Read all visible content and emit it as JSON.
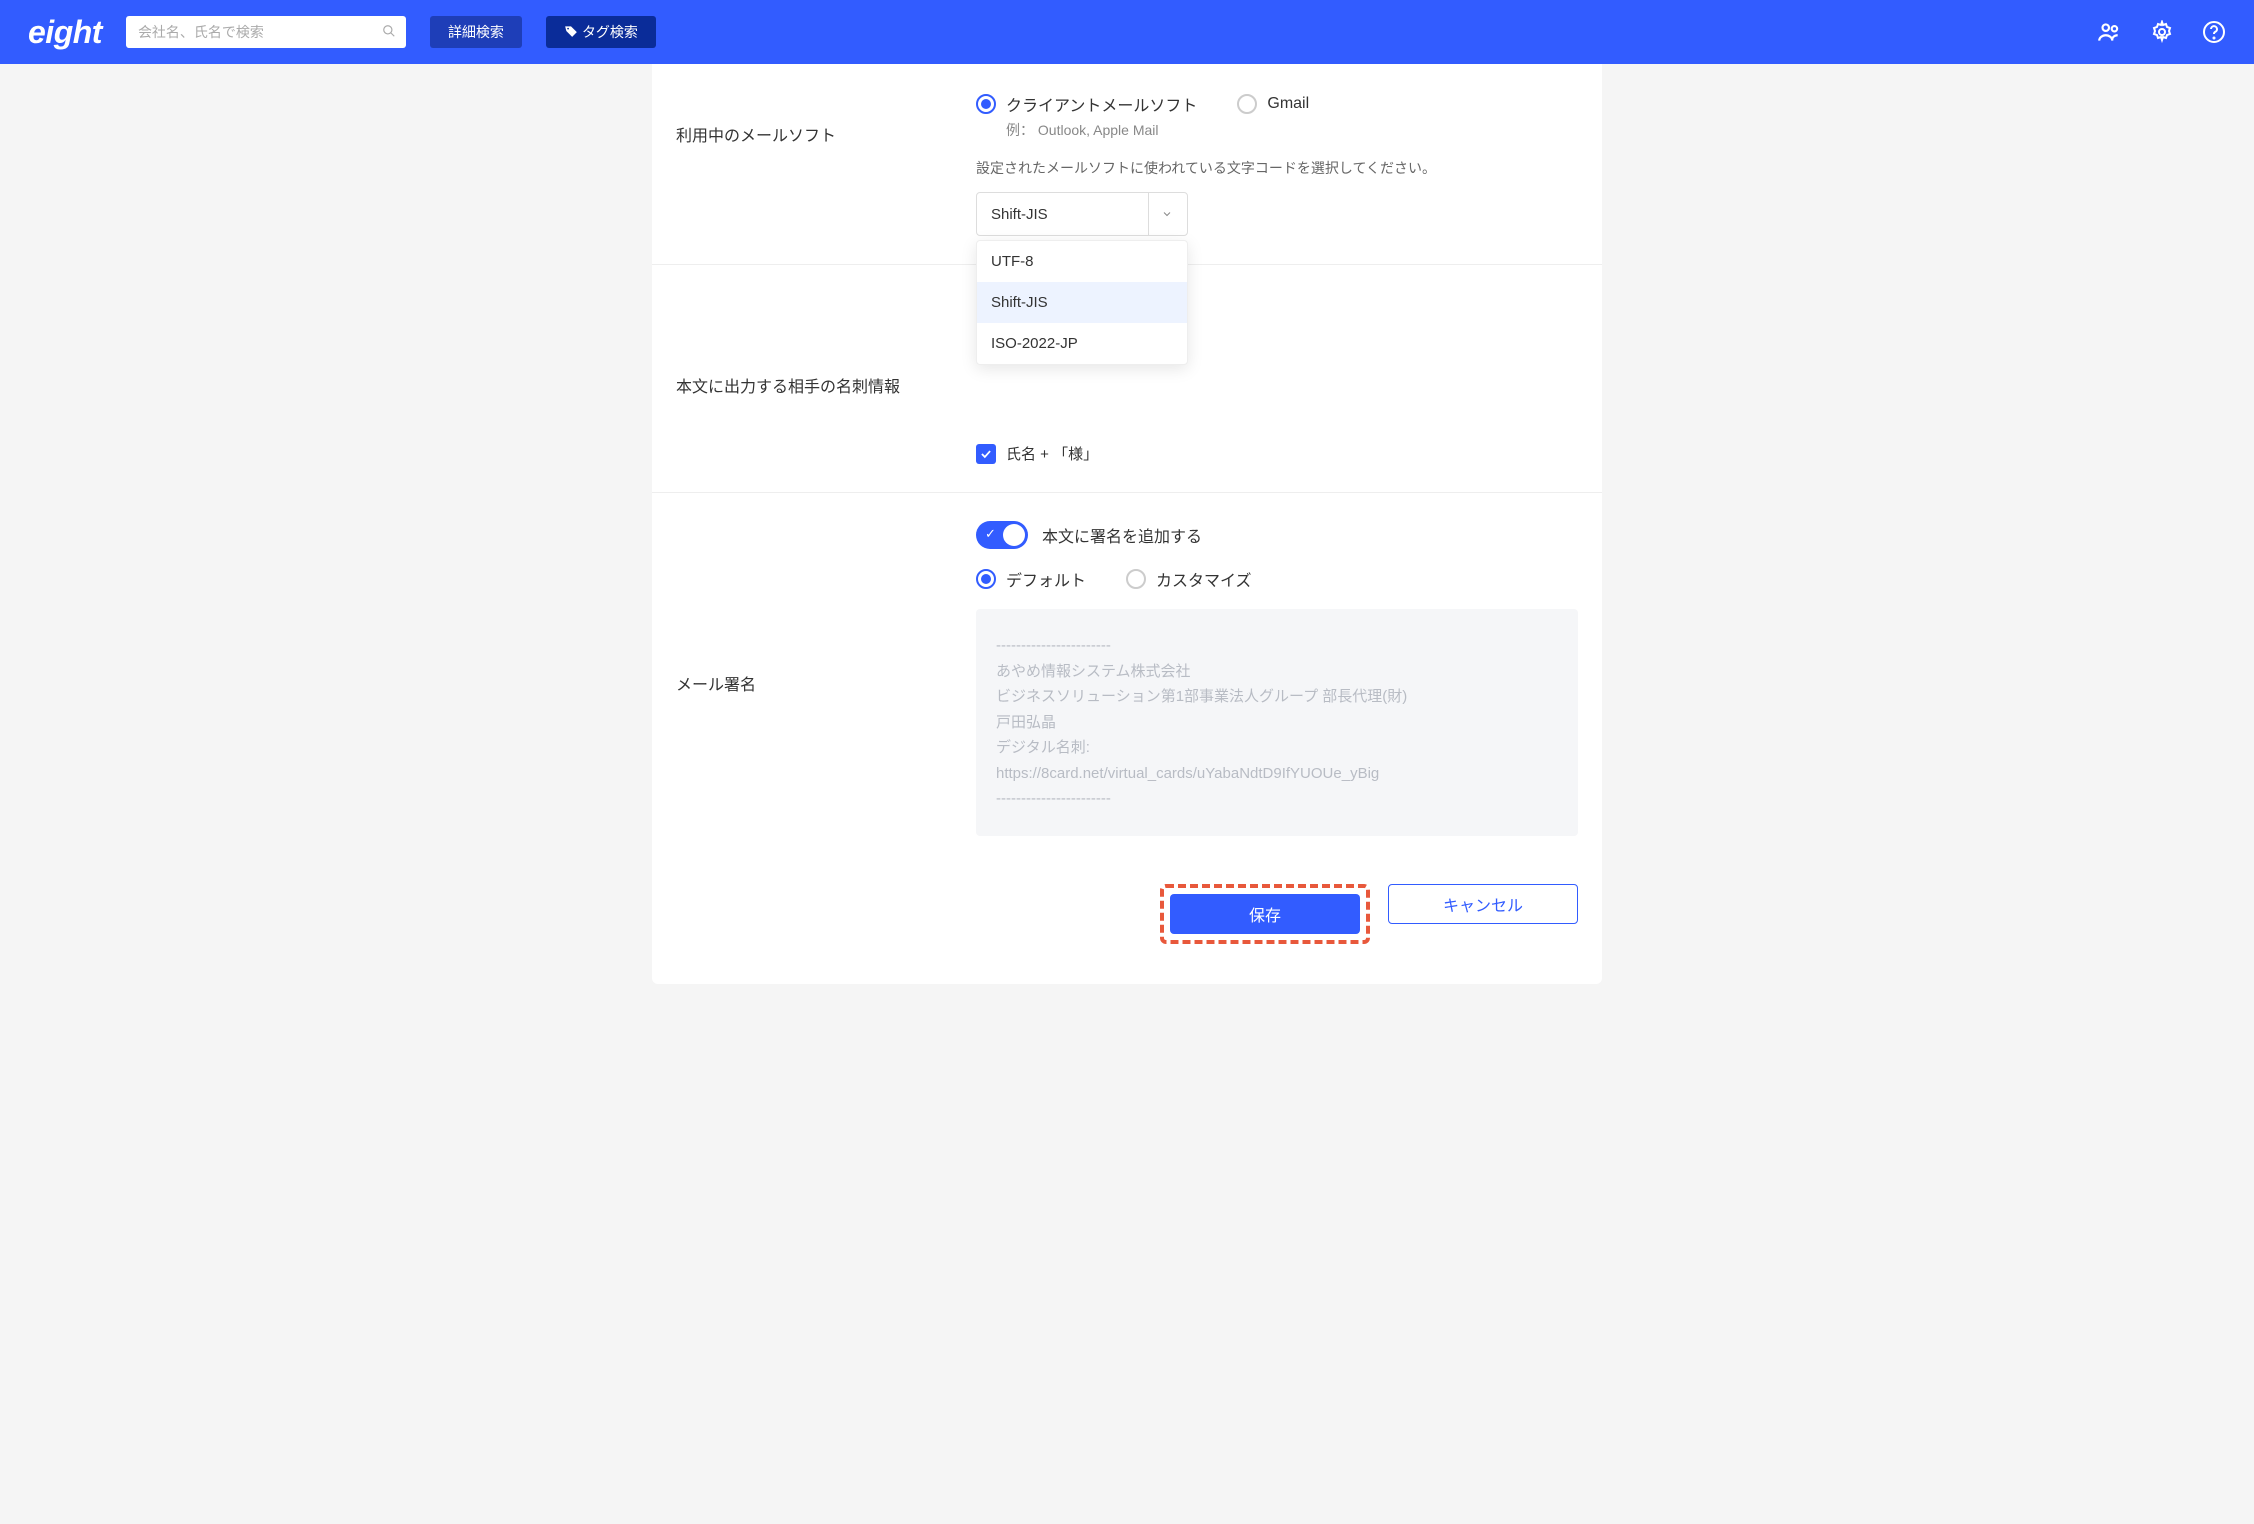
{
  "header": {
    "logo": "eight",
    "search_placeholder": "会社名、氏名で検索",
    "advanced_search": "詳細検索",
    "tag_search": "タグ検索"
  },
  "sections": {
    "mail_client": {
      "label": "利用中のメールソフト",
      "option_client": "クライアントメールソフト",
      "option_gmail": "Gmail",
      "example_hint": "例： Outlook, Apple Mail",
      "encoding_hint": "設定されたメールソフトに使われている文字コードを選択してください。",
      "encoding_selected": "Shift-JIS",
      "encoding_options": [
        "UTF-8",
        "Shift-JIS",
        "ISO-2022-JP"
      ]
    },
    "card_info": {
      "label": "本文に出力する相手の名刺情報",
      "name_suffix": "氏名 + 「様」"
    },
    "signature": {
      "label": "メール署名",
      "toggle_label": "本文に署名を追加する",
      "option_default": "デフォルト",
      "option_custom": "カスタマイズ",
      "preview": "-----------------------\nあやめ情報システム株式会社\nビジネスソリューション第1部事業法人グループ 部長代理(財)\n戸田弘晶\nデジタル名刺:\nhttps://8card.net/virtual_cards/uYabaNdtD9IfYUOUe_yBig\n-----------------------"
    }
  },
  "footer": {
    "save": "保存",
    "cancel": "キャンセル"
  }
}
